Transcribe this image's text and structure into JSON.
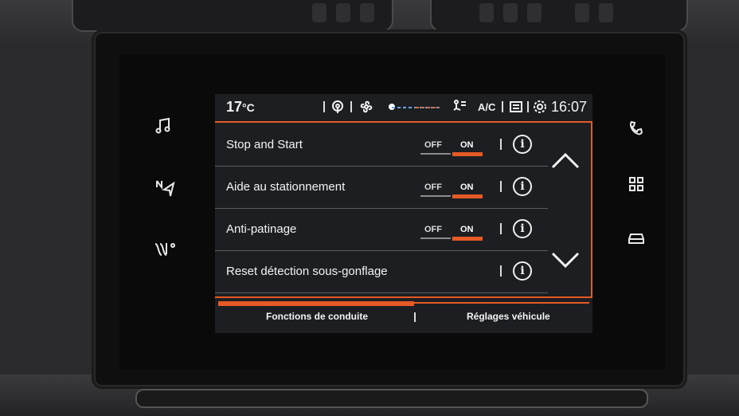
{
  "status_bar": {
    "temperature": "17",
    "temperature_unit": "°C",
    "ac_label": "A/C",
    "time": "16:07",
    "icons": [
      "connectivity-icon",
      "fan-icon",
      "airflow-icon",
      "recirculation-icon",
      "settings-icon"
    ]
  },
  "settings": {
    "rows": [
      {
        "label": "Stop and Start",
        "has_toggle": true,
        "off_label": "OFF",
        "on_label": "ON",
        "state": "ON"
      },
      {
        "label": "Aide au stationnement",
        "has_toggle": true,
        "off_label": "OFF",
        "on_label": "ON",
        "state": "ON"
      },
      {
        "label": "Anti-patinage",
        "has_toggle": true,
        "off_label": "OFF",
        "on_label": "ON",
        "state": "ON"
      },
      {
        "label": "Reset détection sous-gonflage",
        "has_toggle": false
      }
    ]
  },
  "tabs": [
    {
      "label": "Fonctions de conduite",
      "active": true
    },
    {
      "label": "Réglages véhicule",
      "active": false
    }
  ],
  "left_rail": [
    "music-icon",
    "navigation-icon",
    "climate-icon"
  ],
  "right_rail": [
    "phone-icon",
    "apps-grid-icon",
    "car-icon"
  ],
  "colors": {
    "accent": "#e55a25",
    "screen_bg": "#1c1e22"
  }
}
